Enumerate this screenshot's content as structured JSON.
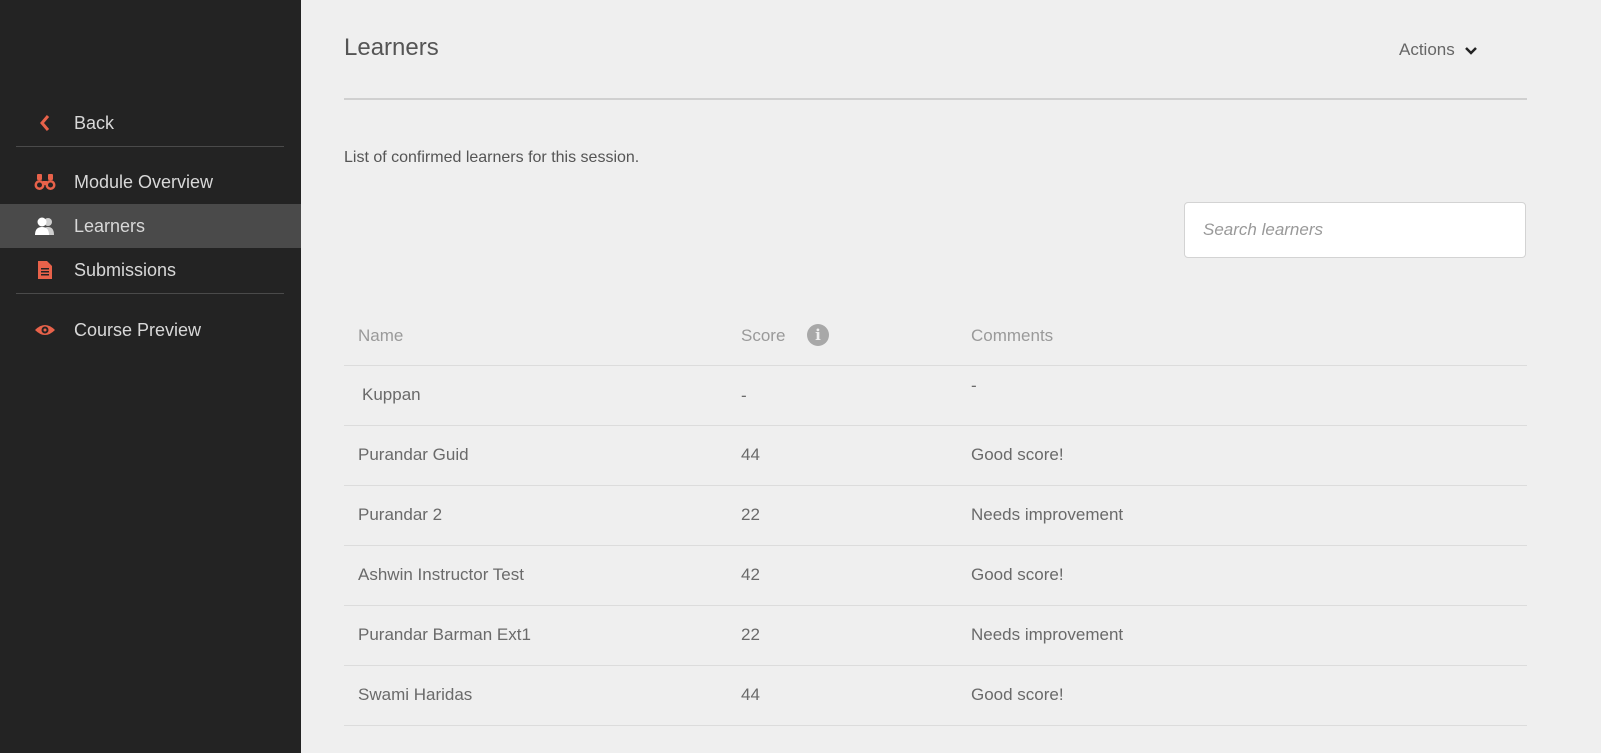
{
  "sidebar": {
    "items": [
      {
        "label": "Back",
        "icon": "chevron-left-icon"
      },
      {
        "label": "Module Overview",
        "icon": "binoculars-icon"
      },
      {
        "label": "Learners",
        "icon": "users-icon",
        "active": true
      },
      {
        "label": "Submissions",
        "icon": "document-icon"
      },
      {
        "label": "Course Preview",
        "icon": "eye-icon"
      }
    ],
    "accent": "#e8624a"
  },
  "header": {
    "title": "Learners",
    "actions_label": "Actions"
  },
  "main": {
    "intro": "List of confirmed learners for this session.",
    "search": {
      "placeholder": "Search learners",
      "value": ""
    },
    "table": {
      "columns": [
        "Name",
        "Score",
        "Comments"
      ],
      "rows": [
        {
          "name": "Kuppan",
          "score": "-",
          "comment": "-"
        },
        {
          "name": "Purandar Guid",
          "score": "44",
          "comment": "Good score!"
        },
        {
          "name": "Purandar 2",
          "score": "22",
          "comment": "Needs improvement"
        },
        {
          "name": "Ashwin Instructor Test",
          "score": "42",
          "comment": "Good score!"
        },
        {
          "name": "Purandar Barman Ext1",
          "score": "22",
          "comment": "Needs improvement"
        },
        {
          "name": "Swami Haridas",
          "score": "44",
          "comment": "Good score!"
        }
      ]
    }
  }
}
